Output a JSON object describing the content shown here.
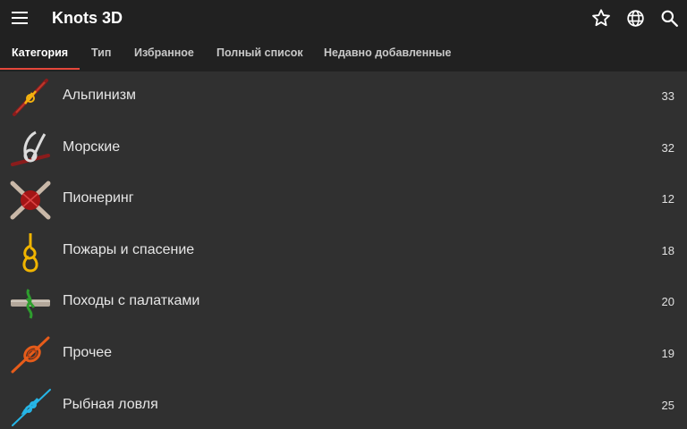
{
  "app": {
    "title": "Knots 3D",
    "background": "#303030",
    "appbar_color": "#212121",
    "accent": "#e5473b"
  },
  "toolbar": {
    "menu_icon": "hamburger-menu-icon",
    "actions": [
      {
        "icon": "star-outline-icon"
      },
      {
        "icon": "globe-icon"
      },
      {
        "icon": "search-icon"
      }
    ]
  },
  "tabs": [
    {
      "label": "Категория",
      "active": true
    },
    {
      "label": "Тип",
      "active": false
    },
    {
      "label": "Избранное",
      "active": false
    },
    {
      "label": "Полный список",
      "active": false
    },
    {
      "label": "Недавно добавленные",
      "active": false
    }
  ],
  "categories": [
    {
      "label": "Альпинизм",
      "count": "33",
      "icon": "climbing-knot-icon",
      "icon_color": "#c0392b"
    },
    {
      "label": "Морские",
      "count": "32",
      "icon": "boating-knot-icon",
      "icon_color": "#bdbdbd"
    },
    {
      "label": "Пионеринг",
      "count": "12",
      "icon": "pioneering-lashing-icon",
      "icon_color": "#b71c1c"
    },
    {
      "label": "Пожары и спасение",
      "count": "18",
      "icon": "rescue-loop-knot-icon",
      "icon_color": "#f0b400"
    },
    {
      "label": "Походы с палатками",
      "count": "20",
      "icon": "camping-hitch-icon",
      "icon_color": "#2e9e2e"
    },
    {
      "label": "Прочее",
      "count": "19",
      "icon": "misc-knot-icon",
      "icon_color": "#e65c1a"
    },
    {
      "label": "Рыбная ловля",
      "count": "25",
      "icon": "fishing-knot-icon",
      "icon_color": "#26b5e6"
    }
  ]
}
